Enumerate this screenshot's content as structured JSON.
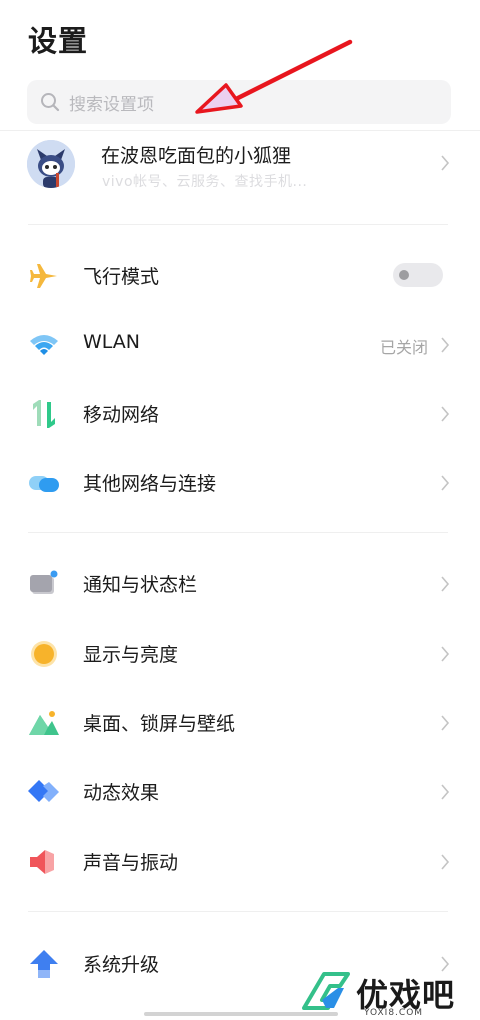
{
  "header": {
    "title": "设置"
  },
  "search": {
    "placeholder": "搜索设置项"
  },
  "profile": {
    "name": "在波恩吃面包的小狐狸",
    "subtitle": "vivo帐号、云服务、查找手机..."
  },
  "settings": [
    {
      "label": "飞行模式",
      "icon": "airplane-icon",
      "control": "toggle",
      "toggle_on": false,
      "accent": "#f5b83d"
    },
    {
      "label": "WLAN",
      "icon": "wifi-icon",
      "value": "已关闭",
      "accent": "#2b9ff0"
    },
    {
      "label": "移动网络",
      "icon": "mobile-network-icon",
      "accent": "#2fc98a"
    },
    {
      "label": "其他网络与连接",
      "icon": "connections-icon",
      "accent": "#3aa8f0"
    },
    {
      "label": "通知与状态栏",
      "icon": "notification-icon",
      "accent": "#9a9aa5"
    },
    {
      "label": "显示与亮度",
      "icon": "brightness-icon",
      "accent": "#f7b32b"
    },
    {
      "label": "桌面、锁屏与壁纸",
      "icon": "wallpaper-icon",
      "accent": "#3fc48c"
    },
    {
      "label": "动态效果",
      "icon": "motion-effects-icon",
      "accent": "#3477f5"
    },
    {
      "label": "声音与振动",
      "icon": "sound-icon",
      "accent": "#f0555a"
    },
    {
      "label": "系统升级",
      "icon": "system-update-icon",
      "accent": "#3f7ff0"
    }
  ],
  "watermark": {
    "text": "优戏吧",
    "url": "YOXI8.COM"
  },
  "annotation": {
    "color": "#e8161e"
  }
}
